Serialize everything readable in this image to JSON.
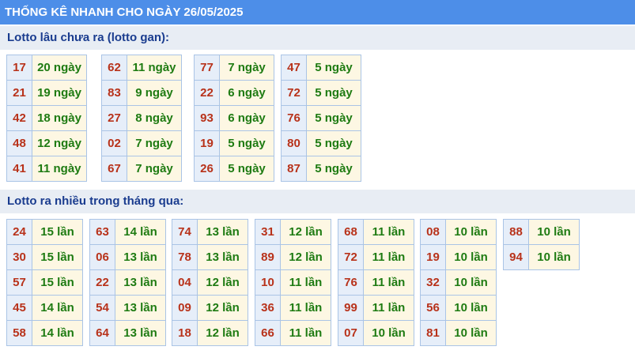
{
  "header": {
    "title": "THỐNG KÊ NHANH CHO NGÀY 26/05/2025"
  },
  "gan": {
    "title": "Lotto lâu chưa ra (lotto gan):",
    "groups": [
      [
        {
          "num": "17",
          "cnt": "20 ngày"
        },
        {
          "num": "21",
          "cnt": "19 ngày"
        },
        {
          "num": "42",
          "cnt": "18 ngày"
        },
        {
          "num": "48",
          "cnt": "12 ngày"
        },
        {
          "num": "41",
          "cnt": "11 ngày"
        }
      ],
      [
        {
          "num": "62",
          "cnt": "11 ngày"
        },
        {
          "num": "83",
          "cnt": "9 ngày"
        },
        {
          "num": "27",
          "cnt": "8 ngày"
        },
        {
          "num": "02",
          "cnt": "7 ngày"
        },
        {
          "num": "67",
          "cnt": "7 ngày"
        }
      ],
      [
        {
          "num": "77",
          "cnt": "7 ngày"
        },
        {
          "num": "22",
          "cnt": "6 ngày"
        },
        {
          "num": "93",
          "cnt": "6 ngày"
        },
        {
          "num": "19",
          "cnt": "5 ngày"
        },
        {
          "num": "26",
          "cnt": "5 ngày"
        }
      ],
      [
        {
          "num": "47",
          "cnt": "5 ngày"
        },
        {
          "num": "72",
          "cnt": "5 ngày"
        },
        {
          "num": "76",
          "cnt": "5 ngày"
        },
        {
          "num": "80",
          "cnt": "5 ngày"
        },
        {
          "num": "87",
          "cnt": "5 ngày"
        }
      ]
    ]
  },
  "frequent": {
    "title": "Lotto ra nhiều trong tháng qua:",
    "groups": [
      [
        {
          "num": "24",
          "cnt": "15 lần"
        },
        {
          "num": "30",
          "cnt": "15 lần"
        },
        {
          "num": "57",
          "cnt": "15 lần"
        },
        {
          "num": "45",
          "cnt": "14 lần"
        },
        {
          "num": "58",
          "cnt": "14 lần"
        }
      ],
      [
        {
          "num": "63",
          "cnt": "14 lần"
        },
        {
          "num": "06",
          "cnt": "13 lần"
        },
        {
          "num": "22",
          "cnt": "13 lần"
        },
        {
          "num": "54",
          "cnt": "13 lần"
        },
        {
          "num": "64",
          "cnt": "13 lần"
        }
      ],
      [
        {
          "num": "74",
          "cnt": "13 lần"
        },
        {
          "num": "78",
          "cnt": "13 lần"
        },
        {
          "num": "04",
          "cnt": "12 lần"
        },
        {
          "num": "09",
          "cnt": "12 lần"
        },
        {
          "num": "18",
          "cnt": "12 lần"
        }
      ],
      [
        {
          "num": "31",
          "cnt": "12 lần"
        },
        {
          "num": "89",
          "cnt": "12 lần"
        },
        {
          "num": "10",
          "cnt": "11 lần"
        },
        {
          "num": "36",
          "cnt": "11 lần"
        },
        {
          "num": "66",
          "cnt": "11 lần"
        }
      ],
      [
        {
          "num": "68",
          "cnt": "11 lần"
        },
        {
          "num": "72",
          "cnt": "11 lần"
        },
        {
          "num": "76",
          "cnt": "11 lần"
        },
        {
          "num": "99",
          "cnt": "11 lần"
        },
        {
          "num": "07",
          "cnt": "10 lần"
        }
      ],
      [
        {
          "num": "08",
          "cnt": "10 lần"
        },
        {
          "num": "19",
          "cnt": "10 lần"
        },
        {
          "num": "32",
          "cnt": "10 lần"
        },
        {
          "num": "56",
          "cnt": "10 lần"
        },
        {
          "num": "81",
          "cnt": "10 lần"
        }
      ],
      [
        {
          "num": "88",
          "cnt": "10 lần"
        },
        {
          "num": "94",
          "cnt": "10 lần"
        }
      ]
    ]
  },
  "colors": {
    "header_bg": "#4d8ee8",
    "section_bg": "#e8edf4",
    "section_text": "#1a3c8f",
    "number_text": "#b8321a",
    "count_text": "#1e7b12",
    "number_cell_bg": "#e6eef9",
    "count_cell_bg": "#fdf7e3"
  }
}
